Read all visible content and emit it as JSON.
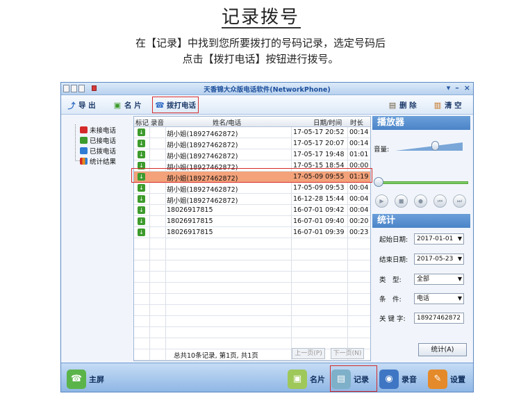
{
  "doc": {
    "title": "记录拨号",
    "instruction_line1": "在【记录】中找到您所要拨打的号码记录，选定号码后",
    "instruction_line2": "点击【拨打电话】按钮进行拨号。"
  },
  "window": {
    "title": "天香锦大众版电话软件(NetworkPhone)",
    "controls": [
      "▾",
      "–",
      "×"
    ]
  },
  "toolbar": {
    "export_label": "导 出",
    "card_label": "名 片",
    "dial_label": "拨打电话",
    "delete_label": "删 除",
    "clear_label": "清 空"
  },
  "tree": {
    "items": [
      {
        "label": "未接电话",
        "icon": "missed-call-icon",
        "color": "#d42a2a"
      },
      {
        "label": "已接电话",
        "icon": "received-call-icon",
        "color": "#3c9b2c"
      },
      {
        "label": "已拨电话",
        "icon": "dialed-call-icon",
        "color": "#2f7bd3"
      },
      {
        "label": "统计结果",
        "icon": "statistics-icon",
        "color": "#e38b1c"
      }
    ]
  },
  "grid": {
    "headers": {
      "mark": "标记",
      "audio": "录音",
      "name": "姓名/电话",
      "datetime": "日期/时间",
      "duration": "时长"
    },
    "rows": [
      {
        "name": "胡小姐(18927462872)",
        "datetime": "17-05-17 20:52",
        "duration": "00:14"
      },
      {
        "name": "胡小姐(18927462872)",
        "datetime": "17-05-17 20:07",
        "duration": "00:14"
      },
      {
        "name": "胡小姐(18927462872)",
        "datetime": "17-05-17 19:48",
        "duration": "01:01"
      },
      {
        "name": "胡小姐(18927462872)",
        "datetime": "17-05-15 18:54",
        "duration": "00:00"
      },
      {
        "name": "胡小姐(18927462872)",
        "datetime": "17-05-09 09:55",
        "duration": "01:19"
      },
      {
        "name": "胡小姐(18927462872)",
        "datetime": "17-05-09 09:53",
        "duration": "00:04"
      },
      {
        "name": "胡小姐(18927462872)",
        "datetime": "16-12-28 15:44",
        "duration": "00:04"
      },
      {
        "name": "18026917815",
        "datetime": "16-07-01 09:42",
        "duration": "00:04"
      },
      {
        "name": "18026917815",
        "datetime": "16-07-01 09:40",
        "duration": "00:20"
      },
      {
        "name": "18026917815",
        "datetime": "16-07-01 09:39",
        "duration": "00:23"
      }
    ],
    "selected_index": 4,
    "summary": "总共10条记录, 第1页, 共1页",
    "prev_label": "上一页(P)",
    "next_label": "下一页(N)"
  },
  "player": {
    "title": "播放器",
    "volume_label": "音量:",
    "volume_level": 0.6,
    "position_level": 0
  },
  "stats": {
    "title": "统计",
    "start_label": "起始日期:",
    "start_value": "2017-01-01",
    "end_label": "结束日期:",
    "end_value": "2017-05-23",
    "type_label": "类　型:",
    "type_value": "全部",
    "cond_label": "条　件:",
    "cond_value": "电话",
    "keyword_label": "关 键 字:",
    "keyword_value": "18927462872",
    "button_label": "统计(A)"
  },
  "bottombar": {
    "home_label": "主屏",
    "card_label": "名片",
    "record_label": "记录",
    "audio_label": "录音",
    "settings_label": "设置"
  }
}
